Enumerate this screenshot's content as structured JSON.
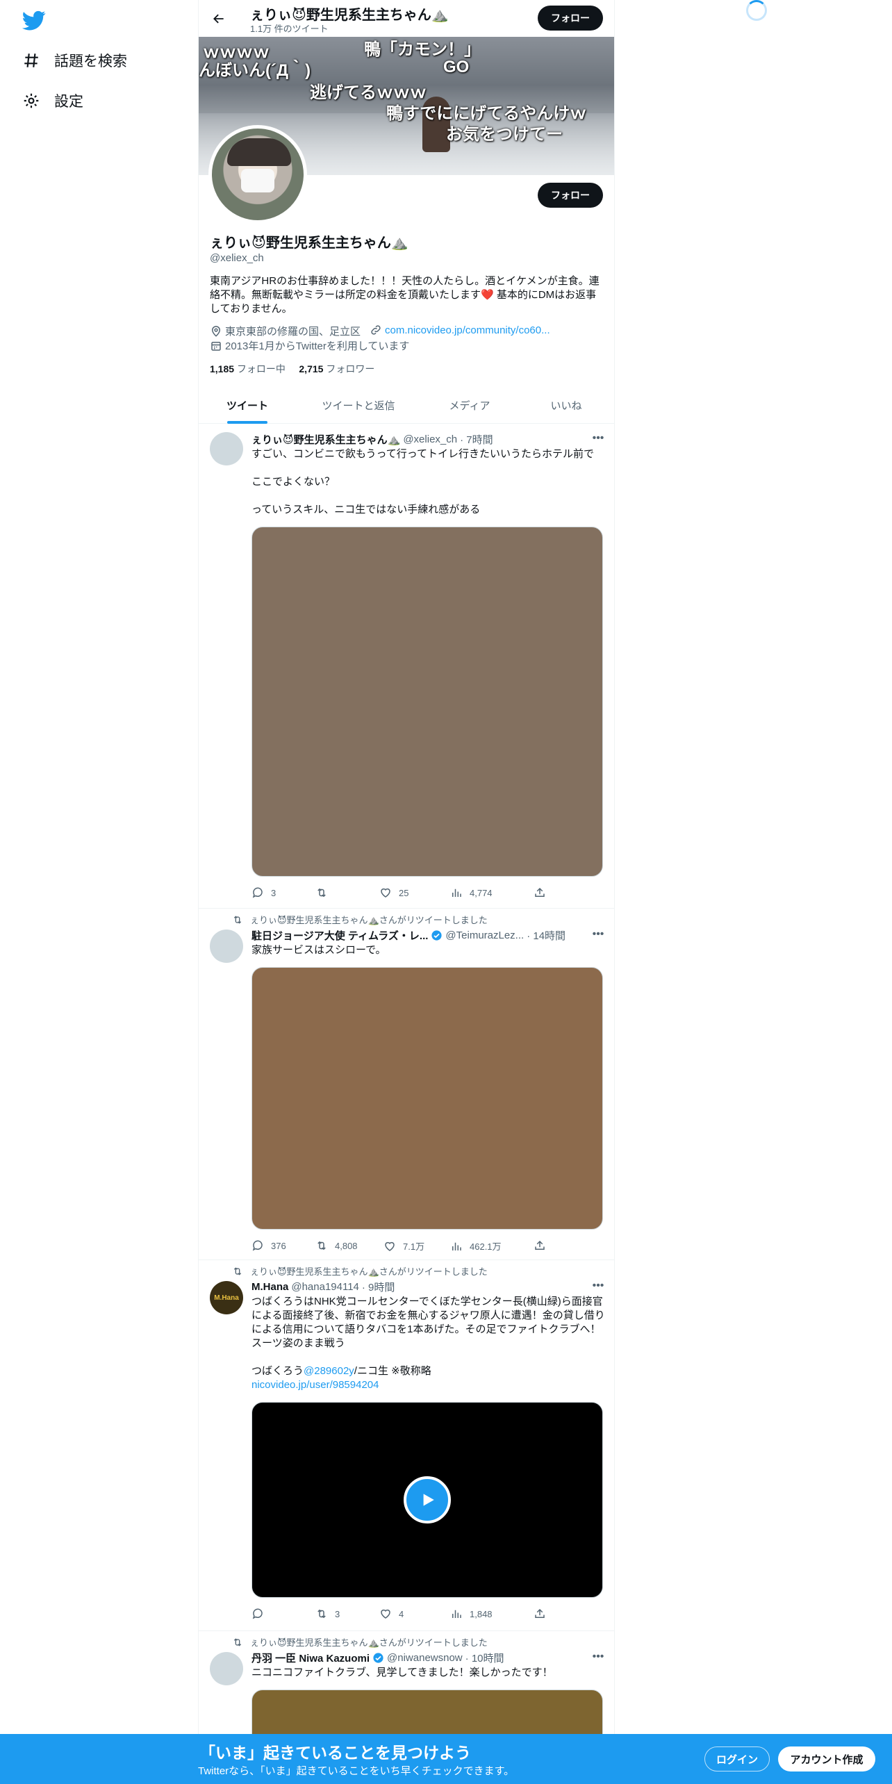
{
  "nav": {
    "explore_label": "話題を検索",
    "settings_label": "設定"
  },
  "header": {
    "title": "ぇりぃ😈野生児系生主ちゃん⛰️",
    "tweet_count": "1.1万 件のツイート",
    "follow_label": "フォロー"
  },
  "banner": {
    "captions": [
      "ｗｗｗｗ",
      "鴨「カモン！」",
      "んぼいん(´Д｀)",
      "GO",
      "逃げてるｗｗｗ",
      "鴨すでににげてるやんけｗ",
      "お気をつけてー"
    ]
  },
  "profile": {
    "follow_label": "フォロー",
    "name": "ぇりぃ😈野生児系生主ちゃん⛰️",
    "handle": "@xeliex_ch",
    "bio": "東南アジアHRのお仕事辞めました！！！天性の人たらし。酒とイケメンが主食。連絡不精。無断転載やミラーは所定の料金を頂戴いたします❤️ 基本的にDMはお返事しておりません。",
    "location": "東京東部の修羅の国、足立区",
    "url": "com.nicovideo.jp/community/co60...",
    "joined": "2013年1月からTwitterを利用しています",
    "following_count": "1,185",
    "following_label": "フォロー中",
    "followers_count": "2,715",
    "followers_label": "フォロワー"
  },
  "tabs": [
    "ツイート",
    "ツイートと返信",
    "メディア",
    "いいね"
  ],
  "tweets": [
    {
      "name": "ぇりぃ😈野生児系生主ちゃん⛰️",
      "handle": "@xeliex_ch",
      "time": "· 7時間",
      "text": "すごい、コンビニで飲もうって行ってトイレ行きたいいうたらホテル前で\n\nここでよくない？\n\nっていうスキル、ニコ生ではない手練れ感がある",
      "media_color": "#83705f",
      "replies": "3",
      "retweets": "",
      "likes": "25",
      "views": "4,774"
    },
    {
      "retweeted_by": "ぇりぃ😈野生児系生主ちゃん⛰️さんがリツイートしました",
      "name": "駐日ジョージア大使 ティムラズ・レ...",
      "handle": "@TeimurazLez...",
      "time": "· 14時間",
      "text": "家族サービスはスシローで。",
      "media_color": "#8c6a4c",
      "replies": "376",
      "retweets": "4,808",
      "likes": "7.1万",
      "views": "462.1万"
    },
    {
      "retweeted_by": "ぇりぃ😈野生児系生主ちゃん⛰️さんがリツイートしました",
      "name": "M.Hana",
      "handle": "@hana194114",
      "time": "· 9時間",
      "text": "つばくろうはNHK党コールセンターでくぼた学センター長(横山緑)ら面接官による面接終了後、新宿でお金を無心するジャワ原人に遭遇！金の貸し借りによる信用について語りタバコを1本あげた。その足でファイトクラブへ！スーツ姿のまま戦う",
      "text2_pre": "つばくろう",
      "text2_mention": "@289602y",
      "text2_post": "/ニコ生 ※敬称略",
      "text2_link": "nicovideo.jp/user/98594204",
      "avatar_label": "M.Hana",
      "media_color": "#000000",
      "replies": "",
      "retweets": "3",
      "likes": "4",
      "views": "1,848"
    },
    {
      "retweeted_by": "ぇりぃ😈野生児系生主ちゃん⛰️さんがリツイートしました",
      "name": "丹羽 一臣 Niwa Kazuomi",
      "handle": "@niwanewsnow",
      "time": "· 10時間",
      "text": "ニコニコファイトクラブ、見学してきました！楽しかったです！",
      "media_color": "#7e6530"
    }
  ],
  "bottom_bar": {
    "title": "「いま」起きていることを見つけよう",
    "subtitle": "Twitterなら、「いま」起きていることをいち早くチェックできます。",
    "login_label": "ログイン",
    "signup_label": "アカウント作成"
  },
  "colors": {
    "accent": "#1d9bf0",
    "text": "#0f1419",
    "muted": "#536471"
  }
}
